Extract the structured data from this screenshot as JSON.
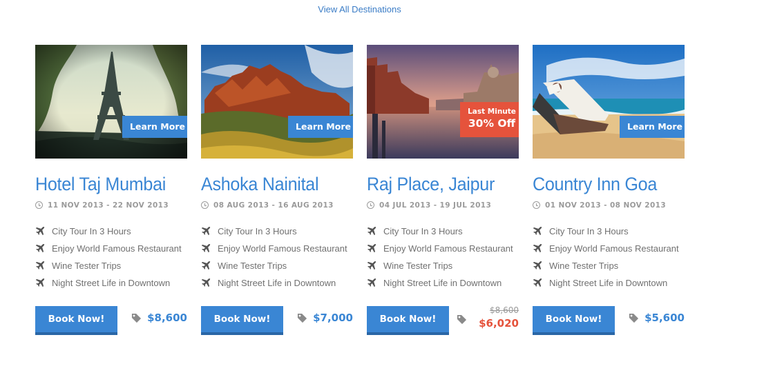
{
  "header": {
    "view_all_label": "View All Destinations"
  },
  "cards": [
    {
      "title": "Hotel Taj Mumbai",
      "dates": "11 NOV 2013 - 22 NOV 2013",
      "action_label": "Learn More",
      "features": [
        "City Tour In 3 Hours",
        "Enjoy World Famous Restaurant",
        "Wine Tester Trips",
        "Night Street Life in Downtown"
      ],
      "book_label": "Book Now!",
      "price": "$8,600"
    },
    {
      "title": "Ashoka Nainital",
      "dates": "08 AUG 2013 - 16 AUG 2013",
      "action_label": "Learn More",
      "features": [
        "City Tour In 3 Hours",
        "Enjoy World Famous Restaurant",
        "Wine Tester Trips",
        "Night Street Life in Downtown"
      ],
      "book_label": "Book Now!",
      "price": "$7,000"
    },
    {
      "title": "Raj Place, Jaipur",
      "dates": "04 JUL 2013 - 19 JUL 2013",
      "badge_line1": "Last Minute",
      "badge_line2": "30% Off",
      "features": [
        "City Tour In 3 Hours",
        "Enjoy World Famous Restaurant",
        "Wine Tester Trips",
        "Night Street Life in Downtown"
      ],
      "book_label": "Book Now!",
      "old_price": "$8,600",
      "price": "$6,020"
    },
    {
      "title": "Country Inn Goa",
      "dates": "01 NOV 2013 - 08 NOV 2013",
      "action_label": "Learn More",
      "features": [
        "City Tour In 3 Hours",
        "Enjoy World Famous Restaurant",
        "Wine Tester Trips",
        "Night Street Life in Downtown"
      ],
      "book_label": "Book Now!",
      "price": "$5,600"
    }
  ],
  "colors": {
    "accent": "#3a86d4",
    "sale": "#e5533c",
    "muted": "#9a9a9a"
  },
  "icons": {
    "date": "clock-icon",
    "feature": "plane-icon",
    "price": "price-tag-icon"
  }
}
